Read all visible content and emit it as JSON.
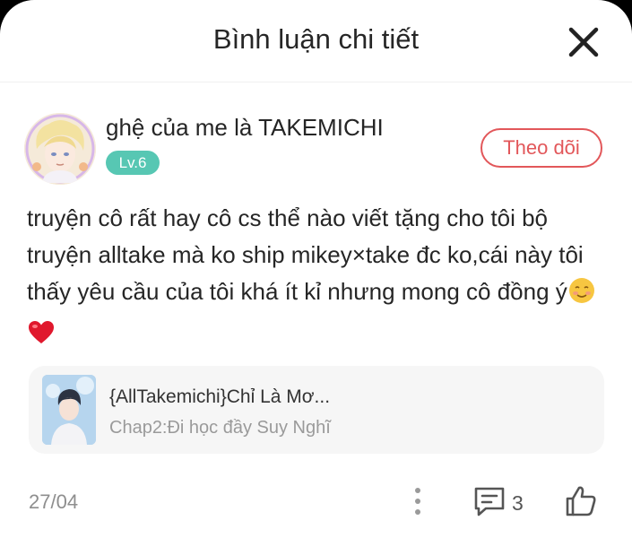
{
  "header": {
    "title": "Bình luận chi tiết"
  },
  "comment": {
    "username": "ghệ của me là TAKEMICHI",
    "level": "Lv.6",
    "follow_label": "Theo dõi",
    "text": "truyện cô rất hay cô cs thể nào viết tặng cho tôi bộ truyện alltake mà ko ship mikey×take đc ko,cái này tôi thấy yêu cầu của tôi khá ít kỉ nhưng mong cô đồng ý",
    "emojis": [
      "smiling-face-emoji",
      "red-heart-emoji"
    ],
    "date": "27/04",
    "reply_count": "3"
  },
  "story": {
    "title": "{AllTakemichi}Chỉ Là Mơ...",
    "chapter": "Chap2:Đi học đầy Suy Nghĩ"
  },
  "colors": {
    "accent_red": "#e2575a",
    "level_badge": "#57c7b3",
    "card_bg": "#f6f6f6",
    "muted_text": "#8e8e8e"
  }
}
